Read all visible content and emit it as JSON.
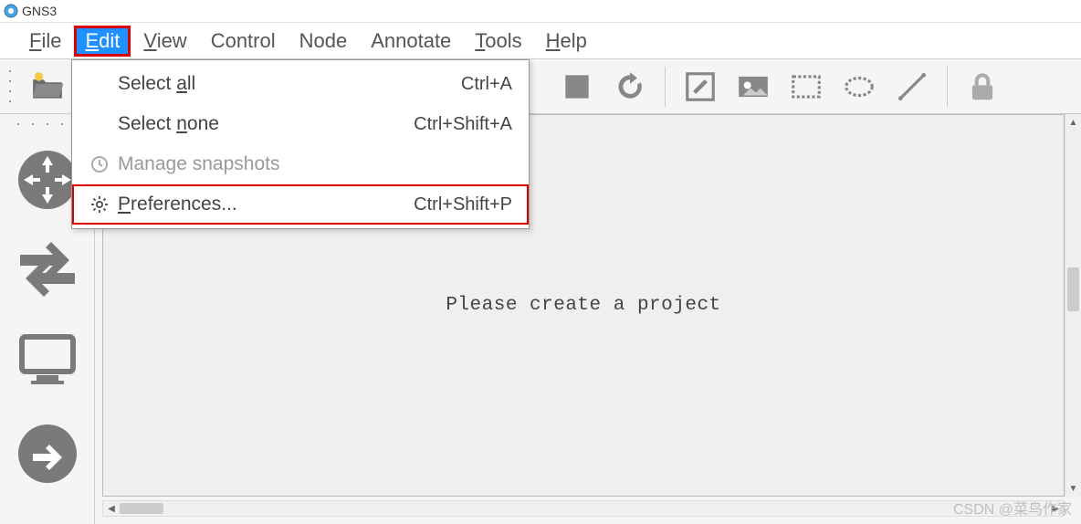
{
  "app_title": "GNS3",
  "menubar": {
    "file": "File",
    "edit": "Edit",
    "view": "View",
    "control": "Control",
    "node": "Node",
    "annotate": "Annotate",
    "tools": "Tools",
    "help": "Help"
  },
  "edit_menu": {
    "select_all": {
      "label_pre": "Select ",
      "label_ul": "a",
      "label_post": "ll",
      "shortcut": "Ctrl+A"
    },
    "select_none": {
      "label_pre": "Select ",
      "label_ul": "n",
      "label_post": "one",
      "shortcut": "Ctrl+Shift+A"
    },
    "manage_snapshots": {
      "label": "Manage snapshots"
    },
    "preferences": {
      "label_ul": "P",
      "label_post": "references...",
      "shortcut": "Ctrl+Shift+P"
    }
  },
  "canvas_message": "Please create a project",
  "watermark": "CSDN @菜鸟作家"
}
